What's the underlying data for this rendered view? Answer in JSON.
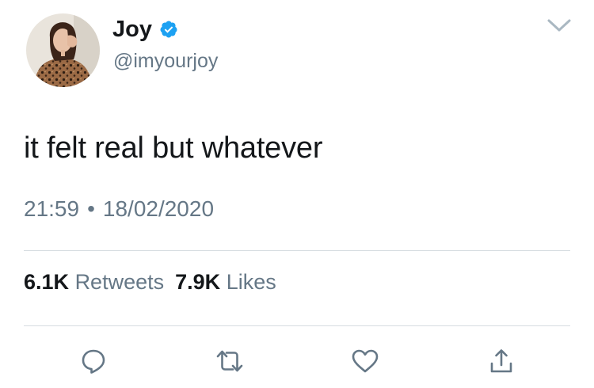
{
  "author": {
    "name": "Joy",
    "handle": "@imyourjoy",
    "verified": true,
    "verified_color": "#1da1f2"
  },
  "tweet": {
    "text": "it felt real but whatever",
    "time": "21:59",
    "separator": "•",
    "date": "18/02/2020"
  },
  "stats": {
    "retweets_count": "6.1K",
    "retweets_label": "Retweets",
    "likes_count": "7.9K",
    "likes_label": "Likes"
  },
  "actions": [
    {
      "icon": "reply-icon"
    },
    {
      "icon": "retweet-icon"
    },
    {
      "icon": "like-icon"
    },
    {
      "icon": "share-icon"
    }
  ],
  "colors": {
    "primary_text": "#14171a",
    "secondary_text": "#657786",
    "icon": "#657786",
    "divider": "#d6dce1"
  }
}
